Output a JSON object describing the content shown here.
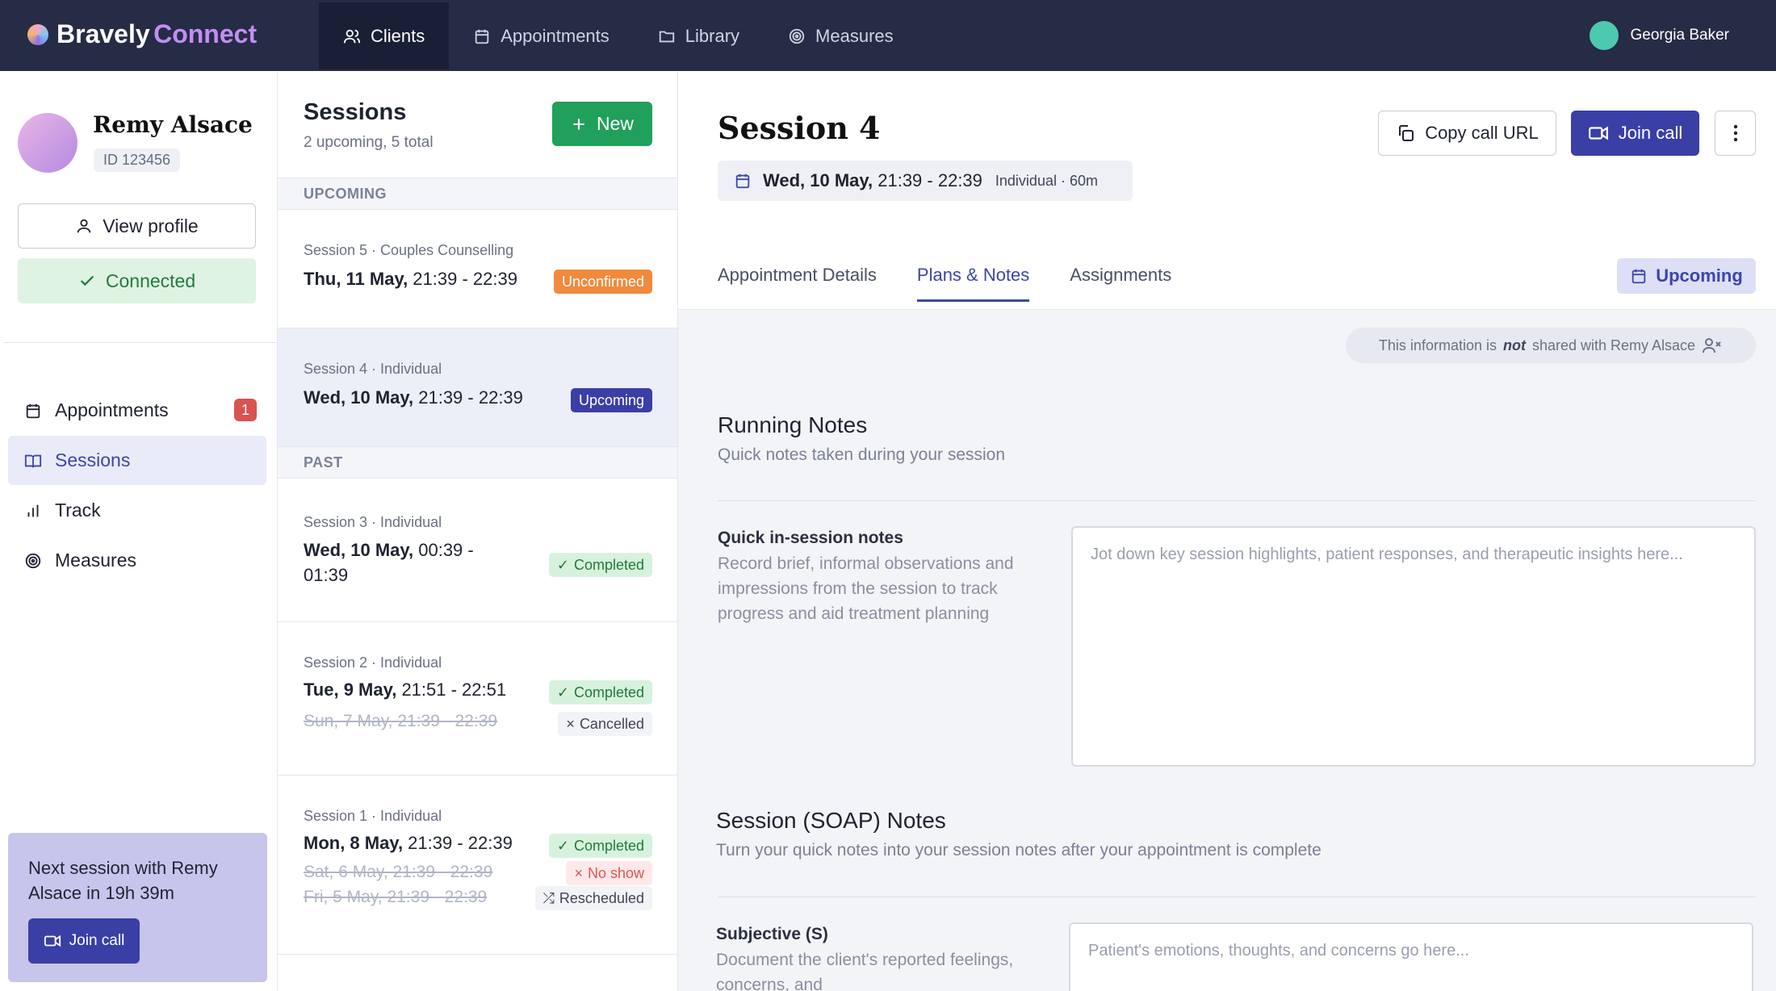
{
  "brand": {
    "name": "Bravely",
    "sub": "Connect"
  },
  "nav": [
    {
      "label": "Clients",
      "icon": "users-icon"
    },
    {
      "label": "Appointments",
      "icon": "calendar-icon"
    },
    {
      "label": "Library",
      "icon": "folder-icon"
    },
    {
      "label": "Measures",
      "icon": "target-icon"
    }
  ],
  "user": {
    "name": "Georgia Baker"
  },
  "client": {
    "name": "Remy Alsace",
    "id": "ID 123456",
    "view_profile": "View profile",
    "connected": "Connected"
  },
  "left_nav": [
    {
      "label": "Appointments",
      "badge": "1"
    },
    {
      "label": "Sessions"
    },
    {
      "label": "Track"
    },
    {
      "label": "Measures"
    }
  ],
  "next_session": {
    "text": "Next session with Remy Alsace in 19h 39m",
    "button": "Join call"
  },
  "sessions": {
    "title": "Sessions",
    "subtitle": "2 upcoming, 5 total",
    "new_button": "New",
    "upcoming_label": "UPCOMING",
    "past_label": "PAST",
    "items": [
      {
        "kind": "Session 5 · Couples Counselling",
        "date": "Thu, 11 May,",
        "time": " 21:39 - 22:39",
        "badge": "Unconfirmed"
      },
      {
        "kind": "Session 4 · Individual",
        "date": "Wed, 10 May,",
        "time": " 21:39 - 22:39",
        "badge": "Upcoming"
      },
      {
        "kind": "Session 3 · Individual",
        "date": "Wed, 10 May,",
        "time": " 00:39 -",
        "time2": "01:39",
        "badge": "Completed"
      },
      {
        "kind": "Session 2 · Individual",
        "date": "Tue, 9 May,",
        "time": " 21:51 - 22:51",
        "badge": "Completed",
        "old": [
          "Sun, 7 May, 21:39 - 22:39"
        ],
        "old_badges": [
          "Cancelled"
        ]
      },
      {
        "kind": "Session 1 · Individual",
        "date": "Mon, 8 May,",
        "time": " 21:39 - 22:39",
        "badge": "Completed",
        "old": [
          "Sat, 6 May, 21:39 - 22:39",
          "Fri, 5 May, 21:39 - 22:39"
        ],
        "old_badges": [
          "No show",
          "Rescheduled"
        ]
      }
    ]
  },
  "main": {
    "title": "Session 4",
    "date": "Wed, 10 May,",
    "time": " 21:39 - 22:39",
    "meta": "Individual · 60m",
    "copy_url": "Copy call URL",
    "join_call": "Join call",
    "tabs": [
      "Appointment Details",
      "Plans & Notes",
      "Assignments"
    ],
    "status": "Upcoming",
    "not_shared_pre": "This information is",
    "not_shared_em": "not",
    "not_shared_post": "shared with Remy Alsace",
    "running_title": "Running Notes",
    "running_sub": "Quick notes taken during your session",
    "quick_label": "Quick in-session notes",
    "quick_help": "Record brief, informal observations and impressions from the session to track progress and aid treatment planning",
    "quick_placeholder": "Jot down key session highlights, patient responses, and therapeutic insights here...",
    "soap_title": "Session (SOAP) Notes",
    "soap_sub": "Turn your quick notes into your session notes after your appointment is complete",
    "subj_label": "Subjective (S)",
    "subj_help": "Document the client's reported feelings, concerns, and",
    "subj_placeholder": "Patient's emotions, thoughts, and concerns go here..."
  },
  "colors": {
    "topbar": "#262c45",
    "accent": "#3a3fa6",
    "success": "#20a05a",
    "warning": "#f08a3c",
    "danger": "#d9534f"
  }
}
